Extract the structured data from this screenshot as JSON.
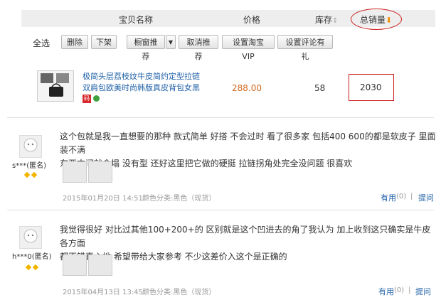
{
  "header": {
    "product_name": "宝贝名称",
    "price": "价格",
    "stock": "库存",
    "stock_arrow": "⇕",
    "sales": "总销量",
    "sales_arrow": "⬇"
  },
  "toolbar": {
    "select_all": "全选",
    "delete": "删除",
    "delist": "下架",
    "window_recommend": "橱窗推荐",
    "dropdown_arrow": "▼",
    "cancel_recommend": "取消推荐",
    "set_vip": "设置淘宝VIP",
    "set_review_gift": "设置评论有礼"
  },
  "product": {
    "title_line1": "极简头层荔枝纹牛皮简约定型拉链",
    "title_line2": "双肩包欧美时尚韩版真皮背包女黑",
    "badge": "码",
    "price": "288.00",
    "stock": "58",
    "sales": "2030"
  },
  "reviews": [
    {
      "text_line1": "这个包就是我一直想要的那种 款式简单 好搭 不会过时 看了很多家 包括400 600的都是软皮子 里面装不满",
      "text_line2": "东西中间就会塌 没有型 还好这里把它做的硬挺 拉链拐角处完全没问题 很喜欢",
      "user": "s***(匿名)",
      "date": "2015年01月20日 14:51",
      "category": "颜色分类:黑色（现货）",
      "useful": "有用",
      "useful_count": "(0)",
      "separator": "|",
      "ask": "提问"
    },
    {
      "text_line1": "我觉得很好 对比过其他100+200+的 区别就是这个凹进去的角了我认为 加上收到这只确实是牛皮 各方面",
      "text_line2": "都不错真心地 希望带给大家参考 不少这差价入这个是正确的",
      "user": "h***0(匿名)",
      "date": "2015年04月13日 13:45",
      "category": "颜色分类:黑色（现货）",
      "useful": "有用",
      "useful_count": "(0)",
      "separator": "|",
      "ask": "提问"
    }
  ],
  "colors": {
    "accent_red": "#cc1f1f",
    "link_blue": "#2262a8",
    "price_orange": "#d2691e",
    "header_bg": "#eeeeee"
  }
}
